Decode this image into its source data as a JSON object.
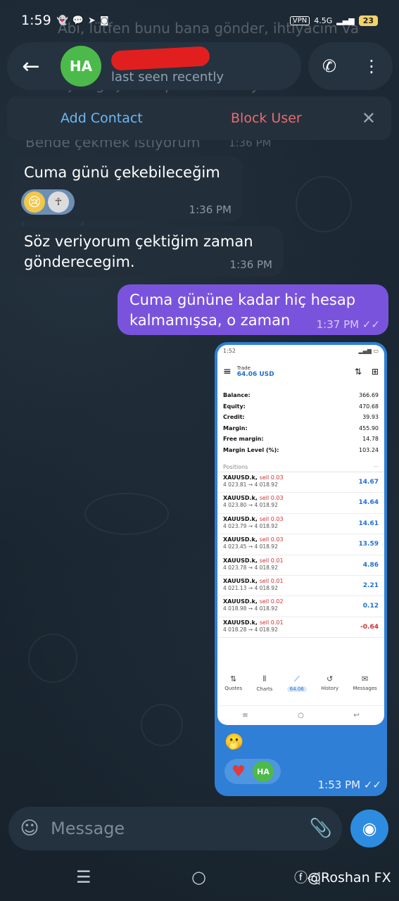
{
  "status": {
    "time": "1:59",
    "vpn": "VPN",
    "network": "4.5G",
    "battery": "23"
  },
  "header": {
    "avatar_initials": "HA",
    "name_redacted": "",
    "last_seen": "last seen recently"
  },
  "actionbar": {
    "add_contact": "Add Contact",
    "block_user": "Block User"
  },
  "ghost_text": {
    "line1": "Abi, lütfen bunu bana gönder, ihtiyacım va",
    "line2": "Kardeşim geçersen parami buraya",
    "line3": "Bende çekmek istiyorum",
    "line3_time": "1:36 PM"
  },
  "messages": [
    {
      "dir": "in",
      "text": "Cuma günü çekebileceğim",
      "time": "1:36 PM"
    },
    {
      "dir": "in",
      "text": "Söz veriyorum çektiğim zaman gönderecegim.",
      "time": "1:36 PM"
    },
    {
      "dir": "out",
      "text": "Cuma gününe kadar hiç hesap kalmamışsa, o zaman",
      "time": "1:37 PM"
    }
  ],
  "screenshot": {
    "status_time": "1:52",
    "title": "Trade",
    "balance_header": "64.06 USD",
    "account": [
      {
        "label": "Balance:",
        "value": "366.69"
      },
      {
        "label": "Equity:",
        "value": "470.68"
      },
      {
        "label": "Credit:",
        "value": "39.93"
      },
      {
        "label": "Margin:",
        "value": "455.90"
      },
      {
        "label": "Free margin:",
        "value": "14.78"
      },
      {
        "label": "Margin Level (%):",
        "value": "103.24"
      }
    ],
    "positions_label": "Positions",
    "positions": [
      {
        "symbol": "XAUUSD.k,",
        "side": "sell 0.03",
        "prices": "4 023.81 → 4 018.92",
        "profit": "14.67"
      },
      {
        "symbol": "XAUUSD.k,",
        "side": "sell 0.03",
        "prices": "4 023.80 → 4 018.92",
        "profit": "14.64"
      },
      {
        "symbol": "XAUUSD.k,",
        "side": "sell 0.03",
        "prices": "4 023.79 → 4 018.92",
        "profit": "14.61"
      },
      {
        "symbol": "XAUUSD.k,",
        "side": "sell 0.03",
        "prices": "4 023.45 → 4 018.92",
        "profit": "13.59"
      },
      {
        "symbol": "XAUUSD.k,",
        "side": "sell 0.01",
        "prices": "4 023.78 → 4 018.92",
        "profit": "4.86"
      },
      {
        "symbol": "XAUUSD.k,",
        "side": "sell 0.01",
        "prices": "4 021.13 → 4 018.92",
        "profit": "2.21"
      },
      {
        "symbol": "XAUUSD.k,",
        "side": "sell 0.02",
        "prices": "4 018.98 → 4 018.92",
        "profit": "0.12"
      },
      {
        "symbol": "XAUUSD.k,",
        "side": "sell 0.01",
        "prices": "4 018.28 → 4 018.92",
        "profit": "-0.64"
      }
    ],
    "tabs": [
      {
        "icon": "⇅",
        "label": "Quotes"
      },
      {
        "icon": "⫴",
        "label": "Charts"
      },
      {
        "icon": "⟋",
        "label": "64.06"
      },
      {
        "icon": "↺",
        "label": "History"
      },
      {
        "icon": "✉",
        "label": "Messages"
      }
    ]
  },
  "photo_message": {
    "emoji": "🫢",
    "reaction_initials": "HA",
    "time": "1:53 PM"
  },
  "input": {
    "placeholder": "Message"
  },
  "watermark": "@Roshan FX",
  "colors": {
    "outgoing_bubble": "#7a53dd",
    "photo_bubble": "#2f7fd6",
    "incoming_bubble": "#222e3a",
    "add_contact": "#6fb7f2",
    "block_user": "#ea6c6c",
    "profit_positive": "#1f6fd6",
    "profit_negative": "#d23030"
  }
}
